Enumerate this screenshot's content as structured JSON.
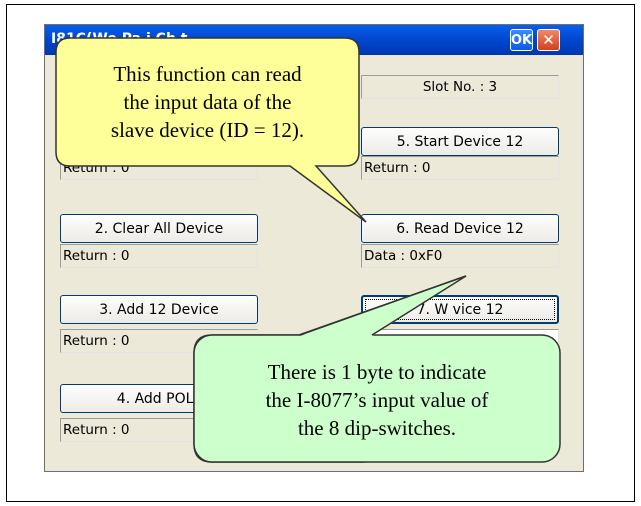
{
  "window": {
    "title": "I81C(Wo Pa i Ch t",
    "ok_label": "OK",
    "close_label": "✕"
  },
  "left": {
    "return1": "Return : 0",
    "clear_all_label": "2. Clear All Device",
    "return2": "Return : 0",
    "add12_label": "3. Add 12 Device",
    "return3": "Return : 0",
    "add_poll_label": "4. Add POLL",
    "return4": "Return : 0"
  },
  "right": {
    "slot_no": "Slot No. : 3",
    "start12_label": "5. Start Device 12",
    "start_return": "Return : 0",
    "read12_label": "6. Read Device 12",
    "read_data": "Data : 0xF0",
    "write12_label": "7. W        vice 12"
  },
  "callouts": {
    "yellow_lines": [
      "This function can read",
      "the input data of the",
      "slave device (ID = 12)."
    ],
    "green_lines": [
      "There is 1 byte to indicate",
      "the I-8077’s input value of",
      "the 8 dip-switches."
    ]
  },
  "colors": {
    "yellow_callout": "#ffff99",
    "green_callout": "#ccffcc",
    "titlebar": "#0044cc"
  }
}
